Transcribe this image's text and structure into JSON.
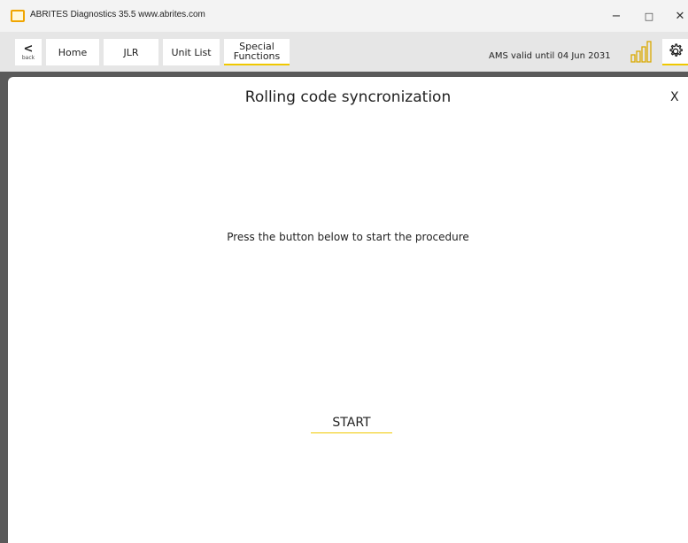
{
  "window": {
    "title": "ABRITES Diagnostics 35.5  www.abrites.com",
    "minimize_glyph": "−",
    "maximize_glyph": "□",
    "close_glyph": "✕"
  },
  "toolbar": {
    "back_arrow": "<",
    "back_label": "back",
    "home_label": "Home",
    "jlr_label": "JLR",
    "unit_list_label": "Unit List",
    "special_functions_line1": "Special",
    "special_functions_line2": "Functions",
    "ams_status": "AMS valid until 04 Jun 2031",
    "signal_icon": "signal-strength-icon",
    "settings_icon": "gear-icon"
  },
  "colors": {
    "accent": "#f0c800",
    "dark_band": "#5a5a5a",
    "toolbar_bg": "#e6e6e6"
  },
  "panel": {
    "title": "Rolling code syncronization",
    "close_label": "X",
    "instruction": "Press the button below to start the procedure",
    "start_label": "START"
  }
}
